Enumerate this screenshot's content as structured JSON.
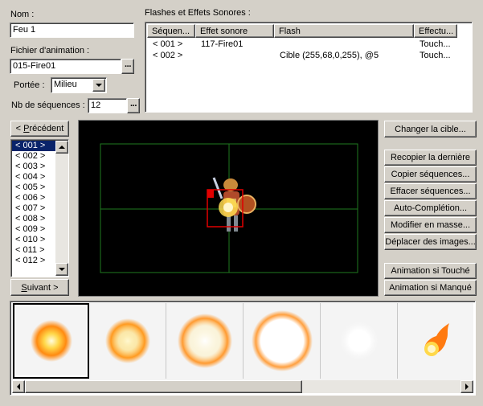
{
  "name_label": "Nom :",
  "name_value": "Feu 1",
  "file_label": "Fichier d'animation :",
  "file_value": "015-Fire01",
  "range_label": "Portée :",
  "range_value": "Milieu",
  "frames_label": "Nb de séquences :",
  "frames_value": "12",
  "timing_label": "Flashes et Effets Sonores :",
  "timing_columns": [
    "Séquen...",
    "Effet sonore",
    "Flash",
    "Effectu..."
  ],
  "timing_rows": [
    {
      "frame": "< 001 >",
      "se": "117-Fire01",
      "flash": "",
      "cond": "Touch..."
    },
    {
      "frame": "< 002 >",
      "se": "",
      "flash": "Cible (255,68,0,255), @5",
      "cond": "Touch..."
    }
  ],
  "prev_button": {
    "accel": "P",
    "pre": "< ",
    "rest": "récédent"
  },
  "next_button": {
    "accel": "S",
    "rest": "uivant >"
  },
  "sequences": [
    "< 001 >",
    "< 002 >",
    "< 003 >",
    "< 004 >",
    "< 005 >",
    "< 006 >",
    "< 007 >",
    "< 008 >",
    "< 009 >",
    "< 010 >",
    "< 011 >",
    "< 012 >"
  ],
  "selected_sequence_index": 0,
  "buttons": {
    "change_target": "Changer la cible...",
    "copy_last": "Recopier la dernière",
    "copy_frames": "Copier séquences...",
    "clear_frames": "Effacer séquences...",
    "tween": "Auto-Complétion...",
    "batch": "Modifier en masse...",
    "shift": "Déplacer des images...",
    "play_hit": "Animation si Touché",
    "play_miss": "Animation si Manqué"
  },
  "colors": {
    "window_bg": "#d4d0c8",
    "canvas_bg": "#000000",
    "grid_line": "#1f7a1f",
    "selection_bg": "#0a246a",
    "cell_box": "#e00000"
  },
  "icons": [
    "ellipsis-icon",
    "dropdown-arrow-icon",
    "scroll-up-icon",
    "scroll-down-icon",
    "scroll-left-icon",
    "scroll-right-icon"
  ]
}
